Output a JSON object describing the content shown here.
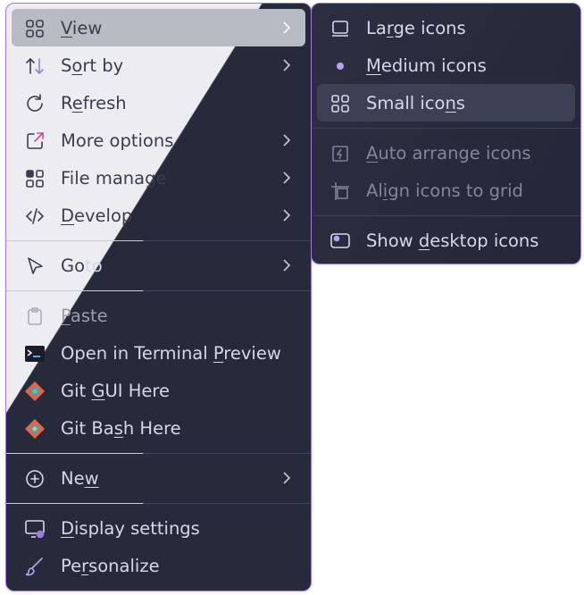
{
  "main_menu": {
    "items": [
      {
        "label": "View",
        "mnemonic_index": 0,
        "icon": "grid-icon",
        "has_submenu": true
      },
      {
        "label": "Sort by",
        "mnemonic_index": 1,
        "icon": "sort-icon",
        "has_submenu": true
      },
      {
        "label": "Refresh",
        "mnemonic_index": 1,
        "icon": "refresh-icon",
        "has_submenu": false
      },
      {
        "label": "More options",
        "icon": "share-box-icon",
        "has_submenu": true
      },
      {
        "label": "File manage",
        "icon": "apps-icon",
        "has_submenu": true
      },
      {
        "label": "Develop",
        "mnemonic_index": 0,
        "icon": "code-icon",
        "has_submenu": true
      },
      {
        "label": "Goto",
        "icon": "cursor-icon",
        "has_submenu": true
      },
      {
        "label": "Paste",
        "mnemonic_index": 0,
        "icon": "clipboard-icon",
        "disabled": true
      },
      {
        "label": "Open in Terminal Preview",
        "icon": "terminal-icon"
      },
      {
        "label": "Git GUI Here",
        "icon": "git-icon"
      },
      {
        "label": "Git Bash Here",
        "icon": "git-icon"
      },
      {
        "label": "New",
        "icon": "plus-circle-icon",
        "has_submenu": true
      },
      {
        "label": "Display settings",
        "icon": "display-settings-icon"
      },
      {
        "label": "Personalize",
        "icon": "brush-icon"
      }
    ]
  },
  "view_submenu": {
    "items": [
      {
        "label": "Large icons",
        "icon": "large-icons-icon"
      },
      {
        "label": "Medium icons",
        "icon": "bullet-icon",
        "checked": true
      },
      {
        "label": "Small icons",
        "icon": "small-icons-icon",
        "highlighted": true
      },
      {
        "label": "Auto arrange icons",
        "icon": "auto-arrange-icon",
        "disabled": true
      },
      {
        "label": "Align icons to grid",
        "icon": "align-grid-icon",
        "disabled": true
      },
      {
        "label": "Show desktop icons",
        "icon": "desktop-icon"
      }
    ]
  },
  "colors": {
    "border": "#a77ae0",
    "light_bg": "#ededf1",
    "dark_bg": "#262a3a",
    "accent": "#9a7ce0"
  }
}
